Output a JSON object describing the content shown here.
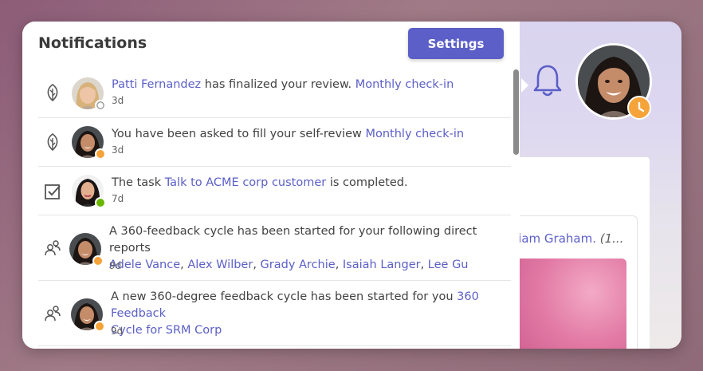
{
  "panel": {
    "title": "Notifications",
    "settings_label": "Settings"
  },
  "background": {
    "name_partial": "riam Graham.",
    "name_paren": "(1..."
  },
  "notifications": [
    {
      "icon": "leaf-icon",
      "avatar": "patti-fernandez",
      "presence": "offline",
      "actor": "Patti Fernandez",
      "text": " has finalized your review. ",
      "link": "Monthly check-in",
      "time": "3d"
    },
    {
      "icon": "leaf-icon",
      "avatar": "user",
      "presence": "away",
      "text": "You have been asked to fill your self-review ",
      "link": "Monthly check-in",
      "time": "3d"
    },
    {
      "icon": "checkbox-icon",
      "avatar": "user",
      "presence": "available",
      "text_before": "The task ",
      "link": "Talk to ACME corp customer",
      "text_after": " is completed.",
      "time": "7d"
    },
    {
      "icon": "people-icon",
      "avatar": "user",
      "presence": "away",
      "text": "A 360-feedback cycle has been started for your following direct reports",
      "people": [
        "Adele Vance",
        "Alex Wilber",
        "Grady Archie",
        "Isaiah Langer",
        "Lee Gu"
      ],
      "separators": [
        ", ",
        ", ",
        ", ",
        ", "
      ],
      "time": "9d"
    },
    {
      "icon": "people-icon",
      "avatar": "user",
      "presence": "away",
      "text": "A new 360-degree feedback cycle has been started for you ",
      "link_line1": "360 Feedback",
      "link_line2": "Cycle for SRM Corp",
      "time": "9d"
    }
  ],
  "colors": {
    "accent": "#5b5fc7",
    "away": "#f6a33a",
    "available": "#6bb700",
    "offline": "#c8c8c8"
  }
}
